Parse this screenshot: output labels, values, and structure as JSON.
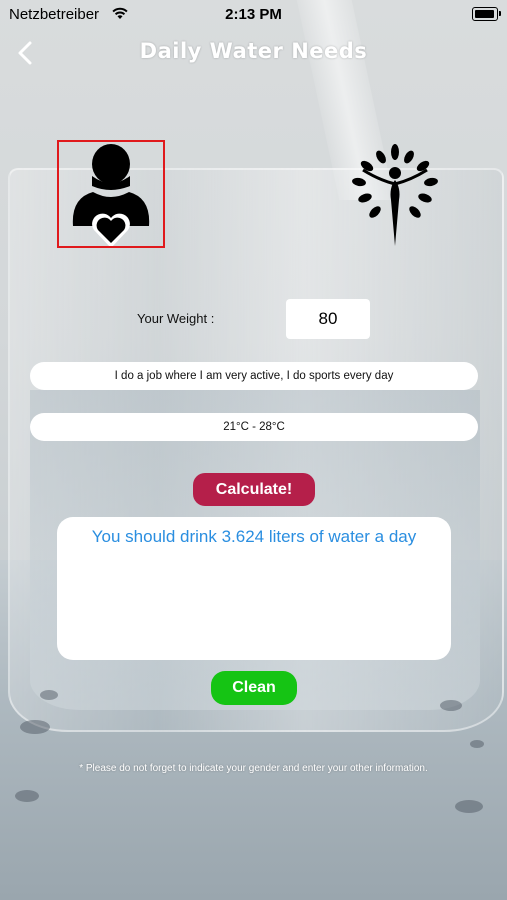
{
  "status_bar": {
    "carrier": "Netzbetreiber",
    "time": "2:13 PM",
    "wifi_icon": "wifi-icon",
    "battery_icon": "battery-icon"
  },
  "nav": {
    "title": "Daily Water Needs",
    "back_icon": "chevron-left-icon"
  },
  "gender": {
    "male_icon": "male-person-heart-icon",
    "female_icon": "female-figure-leaves-icon",
    "selected": "male",
    "selection_color": "#e0191c"
  },
  "form": {
    "weight_label": "Your Weight :",
    "weight_value": "80",
    "activity": "I do a job where I am very active, I do sports every day",
    "temperature": "21°C - 28°C"
  },
  "actions": {
    "calculate_label": "Calculate!",
    "calculate_color": "#b51f4a",
    "clean_label": "Clean",
    "clean_color": "#15c414"
  },
  "result": {
    "text": "You should drink 3.624 liters of water a day",
    "color": "#2a8ee0"
  },
  "note": "* Please do not forget to indicate your gender and enter your other information."
}
